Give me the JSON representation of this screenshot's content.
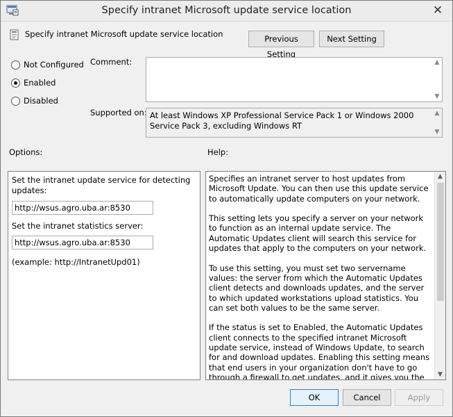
{
  "window": {
    "title": "Specify intranet Microsoft update service location",
    "close_glyph": "✕"
  },
  "header": {
    "policy_name": "Specify intranet Microsoft update service location",
    "previous_label": "Previous Setting",
    "next_label": "Next Setting"
  },
  "state": {
    "options": [
      {
        "label": "Not Configured",
        "checked": false
      },
      {
        "label": "Enabled",
        "checked": true
      },
      {
        "label": "Disabled",
        "checked": false
      }
    ]
  },
  "comment": {
    "label": "Comment:",
    "value": ""
  },
  "supported": {
    "label": "Supported on:",
    "value": "At least Windows XP Professional Service Pack 1 or Windows 2000 Service Pack 3, excluding Windows RT"
  },
  "options_section": {
    "heading": "Options:",
    "detect_label": "Set the intranet update service for detecting updates:",
    "detect_value": "http://wsus.agro.uba.ar:8530",
    "stats_label": "Set the intranet statistics server:",
    "stats_value": "http://wsus.agro.uba.ar:8530",
    "example": "(example: http://IntranetUpd01)"
  },
  "help_section": {
    "heading": "Help:",
    "paragraphs": [
      "Specifies an intranet server to host updates from Microsoft Update. You can then use this update service to automatically update computers on your network.",
      "This setting lets you specify a server on your network to function as an internal update service. The Automatic Updates client will search this service for updates that apply to the computers on your network.",
      "To use this setting, you must set two servername values: the server from which the Automatic Updates client detects and downloads updates, and the server to which updated workstations upload statistics. You can set both values to be the same server.",
      "If the status is set to Enabled, the Automatic Updates client connects to the specified intranet Microsoft update service, instead of Windows Update, to search for and download updates. Enabling this setting means that end users in your organization don't have to go through a firewall to get updates, and it gives you the opportunity to test updates before deploying"
    ]
  },
  "footer": {
    "ok_label": "OK",
    "cancel_label": "Cancel",
    "apply_label": "Apply"
  },
  "colors": {
    "window_bg": "#f0f0f0",
    "accent_border": "#3c7fb1"
  },
  "icons": {
    "title": "group-policy-window-icon",
    "policy": "policy-setting-icon",
    "scroll_up": "scroll-up-arrow-icon",
    "scroll_down": "scroll-down-arrow-icon"
  }
}
